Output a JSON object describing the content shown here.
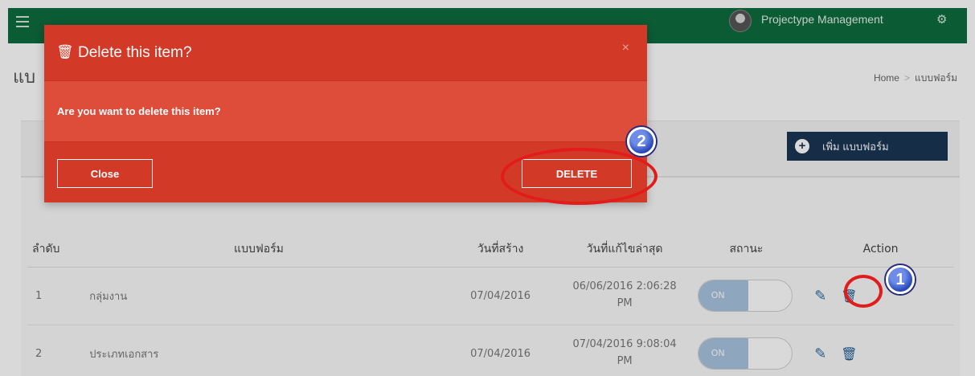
{
  "navbar": {
    "brand": "Projectype Management"
  },
  "page": {
    "title": "แบ",
    "breadcrumb": [
      "Home",
      "แบบฟอร์ม"
    ]
  },
  "toolbar": {
    "add_label": "เพิ่ม แบบฟอร์ม"
  },
  "table": {
    "headers": [
      "ลำดับ",
      "แบบฟอร์ม",
      "วันที่สร้าง",
      "วันที่แก้ไขล่าสุด",
      "สถานะ",
      "Action"
    ],
    "rows": [
      {
        "num": "1",
        "name": "กลุ่มงาน",
        "created": "07/04/2016",
        "updated_line1": "06/06/2016 2:06:28",
        "updated_line2": "PM",
        "status": "ON"
      },
      {
        "num": "2",
        "name": "ประเภทเอกสาร",
        "created": "07/04/2016",
        "updated_line1": "07/04/2016 9:08:04",
        "updated_line2": "PM",
        "status": "ON"
      }
    ]
  },
  "modal": {
    "title": "Delete this item?",
    "close_glyph": "×",
    "message": "Are you want to delete this item?",
    "close_label": "Close",
    "delete_label": "DELETE"
  },
  "annotations": {
    "step1": "1",
    "step2": "2",
    "ring_color": "#e21b1b"
  },
  "icons": {
    "menu": "hamburger-icon",
    "settings": "gears-icon",
    "add": "plus-circle-icon",
    "edit": "pencil-icon",
    "delete": "trash-icon"
  },
  "colors": {
    "navbar": "#0e6b3e",
    "modal": "#d33927",
    "primary_button": "#1a3654",
    "toggle_on": "#a9c4e1"
  }
}
